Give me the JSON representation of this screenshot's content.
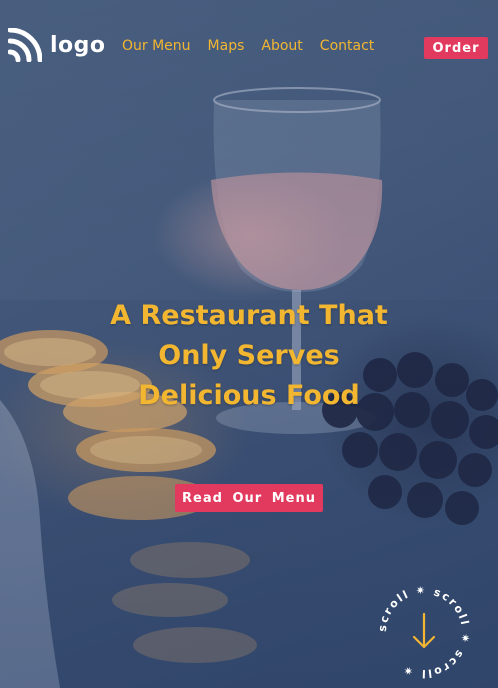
{
  "brand": {
    "logo_text": "logo",
    "logo_icon": "rss-arcs-icon"
  },
  "nav": {
    "items": [
      {
        "label": "Our Menu"
      },
      {
        "label": "Maps"
      },
      {
        "label": "About"
      },
      {
        "label": "Contact"
      }
    ],
    "order_label": "Order"
  },
  "hero": {
    "headline_lines": [
      "A Restaurant That",
      "Only Serves",
      "Delicious Food"
    ],
    "cta_label": "Read Our Menu"
  },
  "scroll_badge": {
    "text": "scroll ✷ scroll ✷ scroll ✷",
    "icon": "arrow-down-icon"
  },
  "colors": {
    "accent": "#f2b631",
    "button": "#e23a5e",
    "text_light": "#ffffff"
  }
}
